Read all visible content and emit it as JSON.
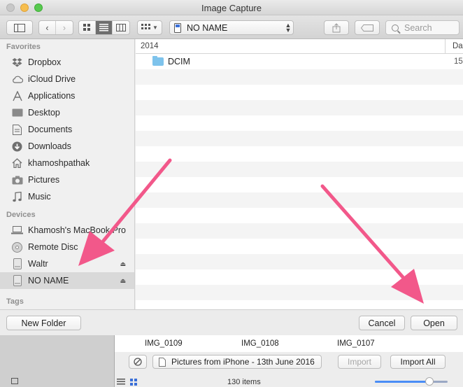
{
  "window": {
    "title": "Image Capture"
  },
  "toolbar": {
    "location_label": "NO NAME",
    "search_placeholder": "Search"
  },
  "sidebar": {
    "favorites_header": "Favorites",
    "favorites": [
      {
        "label": "Dropbox",
        "icon": "dropbox-icon"
      },
      {
        "label": "iCloud Drive",
        "icon": "cloud-icon"
      },
      {
        "label": "Applications",
        "icon": "applications-icon"
      },
      {
        "label": "Desktop",
        "icon": "desktop-icon"
      },
      {
        "label": "Documents",
        "icon": "documents-icon"
      },
      {
        "label": "Downloads",
        "icon": "downloads-icon"
      },
      {
        "label": "khamoshpathak",
        "icon": "home-icon"
      },
      {
        "label": "Pictures",
        "icon": "camera-icon"
      },
      {
        "label": "Music",
        "icon": "music-icon"
      }
    ],
    "devices_header": "Devices",
    "devices": [
      {
        "label": "Khamosh's MacBook Pro",
        "icon": "laptop-icon"
      },
      {
        "label": "Remote Disc",
        "icon": "disc-icon"
      },
      {
        "label": "Waltr",
        "icon": "drive-icon"
      },
      {
        "label": "NO NAME",
        "icon": "drive-icon"
      }
    ],
    "tags_header": "Tags"
  },
  "file_list": {
    "name_column": "2014",
    "date_column": "Da",
    "rows": [
      {
        "name": "DCIM",
        "date": "15"
      }
    ]
  },
  "dialog": {
    "new_folder": "New Folder",
    "cancel": "Cancel",
    "open": "Open"
  },
  "background_window": {
    "thumbnails": [
      "IMG_0109",
      "IMG_0108",
      "IMG_0107"
    ],
    "import_to": "Pictures from iPhone - 13th June 2016",
    "import": "Import",
    "import_all": "Import All",
    "item_count": "130 items",
    "thumbnail_size_fraction": 0.75
  },
  "colors": {
    "annotation_arrow": "#f2588a",
    "folder": "#7ec3ec",
    "accent": "#4a8df6"
  }
}
